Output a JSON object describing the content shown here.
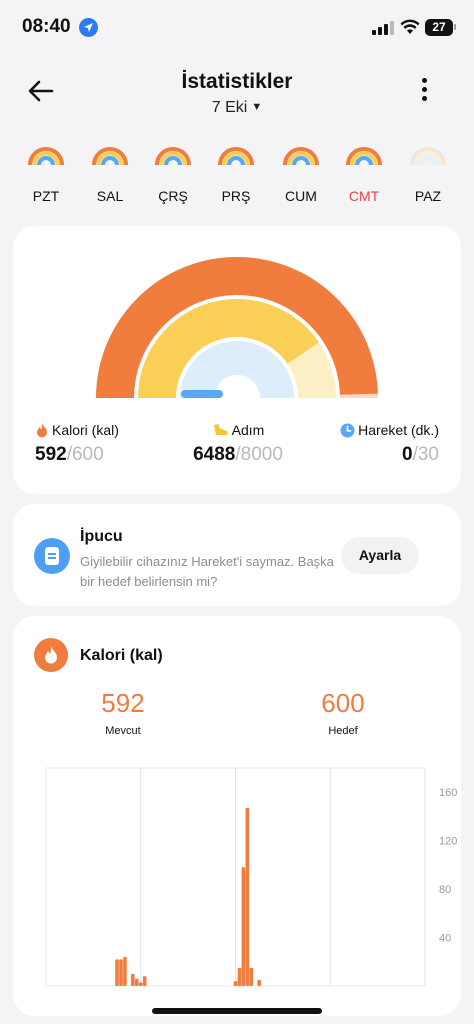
{
  "status_bar": {
    "time": "08:40",
    "battery": "27"
  },
  "header": {
    "title": "İstatistikler",
    "date": "7 Eki"
  },
  "week": [
    {
      "label": "PZT",
      "state": "normal"
    },
    {
      "label": "SAL",
      "state": "normal"
    },
    {
      "label": "ÇRŞ",
      "state": "normal"
    },
    {
      "label": "PRŞ",
      "state": "normal"
    },
    {
      "label": "CUM",
      "state": "normal"
    },
    {
      "label": "CMT",
      "state": "active"
    },
    {
      "label": "PAZ",
      "state": "faded"
    }
  ],
  "summary": {
    "calories": {
      "label": "Kalori (kal)",
      "value": "592",
      "goal": "/600",
      "progress": 0.99
    },
    "steps": {
      "label": "Adım",
      "value": "6488",
      "goal": "/8000",
      "progress": 0.81
    },
    "movement": {
      "label": "Hareket (dk.)",
      "value": "0",
      "goal": "/30",
      "progress": 0.0
    }
  },
  "tip": {
    "title": "İpucu",
    "text": "Giyilebilir cihazınız Hareket'i saymaz. Başka bir hedef belirlensin mi?",
    "button": "Ayarla"
  },
  "calorie_card": {
    "title": "Kalori (kal)",
    "current_value": "592",
    "current_label": "Mevcut",
    "goal_value": "600",
    "goal_label": "Hedef"
  },
  "colors": {
    "accent_orange": "#f07c3e",
    "steps_yellow": "#f9d055",
    "movement_blue": "#5aa8f2",
    "active_day_red": "#e8443a"
  },
  "chart_data": {
    "type": "bar",
    "title": "",
    "xlabel": "",
    "ylabel": "",
    "ylim": [
      0,
      180
    ],
    "yticks": [
      "40",
      "80",
      "120",
      "160"
    ],
    "x": [
      18,
      19,
      20,
      22,
      23,
      24,
      25,
      48,
      49,
      50,
      51,
      52,
      54
    ],
    "values": [
      22,
      22,
      24,
      10,
      6,
      3,
      8,
      4,
      15,
      98,
      147,
      15,
      5
    ],
    "grid": true
  }
}
